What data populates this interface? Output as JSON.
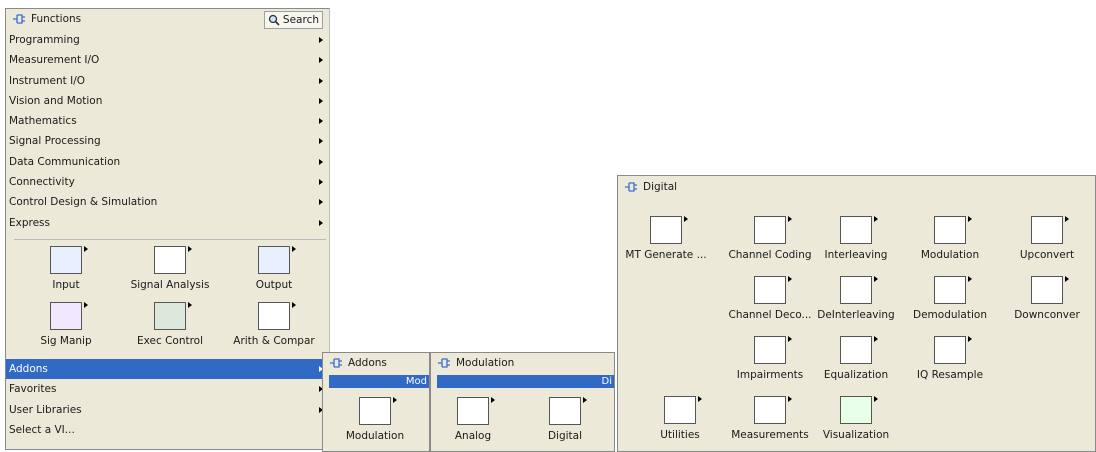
{
  "functions": {
    "title": "Functions",
    "search_label": "Search",
    "menu": [
      {
        "label": "Programming",
        "arrow": true
      },
      {
        "label": "Measurement I/O",
        "arrow": true
      },
      {
        "label": "Instrument I/O",
        "arrow": true
      },
      {
        "label": "Vision and Motion",
        "arrow": true
      },
      {
        "label": "Mathematics",
        "arrow": true
      },
      {
        "label": "Signal Processing",
        "arrow": true
      },
      {
        "label": "Data Communication",
        "arrow": true
      },
      {
        "label": "Connectivity",
        "arrow": true
      },
      {
        "label": "Control Design & Simulation",
        "arrow": true
      },
      {
        "label": "Express",
        "arrow": true
      }
    ],
    "express_icons": [
      "Input",
      "Signal Analysis",
      "Output",
      "Sig Manip",
      "Exec Control",
      "Arith & Compar"
    ],
    "bottom_menu": [
      {
        "label": "Addons",
        "selected": true
      },
      {
        "label": "Favorites"
      },
      {
        "label": "User Libraries"
      },
      {
        "label": "Select a VI..."
      }
    ]
  },
  "addons": {
    "title": "Addons",
    "selected_text": "Mod",
    "icons": [
      "Modulation"
    ]
  },
  "modulation": {
    "title": "Modulation",
    "selected_text": "Di",
    "icons": [
      "Analog",
      "Digital"
    ]
  },
  "digital": {
    "title": "Digital",
    "icons": [
      "MT Generate ...",
      "Channel Coding",
      "Interleaving",
      "Modulation",
      "Upconvert",
      "Channel Deco...",
      "DeInterleaving",
      "Demodulation",
      "Downconver",
      "Impairments",
      "Equalization",
      "IQ Resample",
      "Utilities",
      "Measurements",
      "Visualization"
    ]
  }
}
